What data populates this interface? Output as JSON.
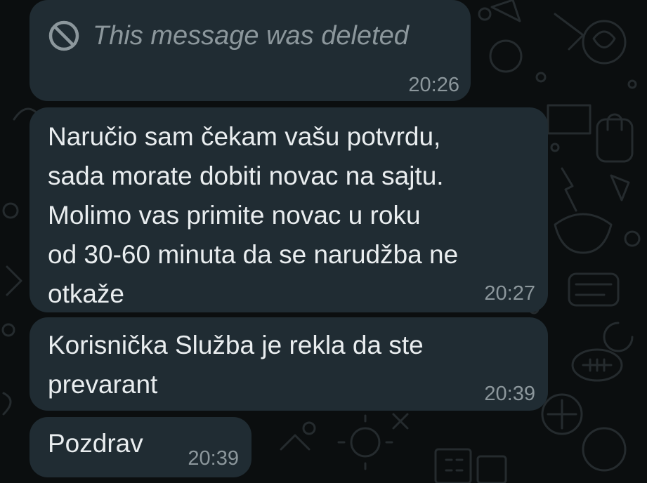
{
  "chat": {
    "messages": [
      {
        "type": "deleted",
        "text": "This message was deleted",
        "time": "20:26",
        "icon": "prohibited-icon"
      },
      {
        "type": "text",
        "text": "Naručio sam čekam vašu potvrdu,\nsada morate dobiti novac na sajtu.\nMolimo vas primite novac u roku\nod 30-60 minuta da se narudžba ne\notkaže",
        "time": "20:27"
      },
      {
        "type": "text",
        "text": "Korisnička Služba je rekla da ste\nprevarant",
        "time": "20:39"
      },
      {
        "type": "text",
        "text": "Pozdrav",
        "time": "20:39"
      }
    ]
  },
  "theme": {
    "background": "#0b0e0f",
    "bubble": "#202c33",
    "text": "#e9edef",
    "meta": "#8c979c"
  }
}
